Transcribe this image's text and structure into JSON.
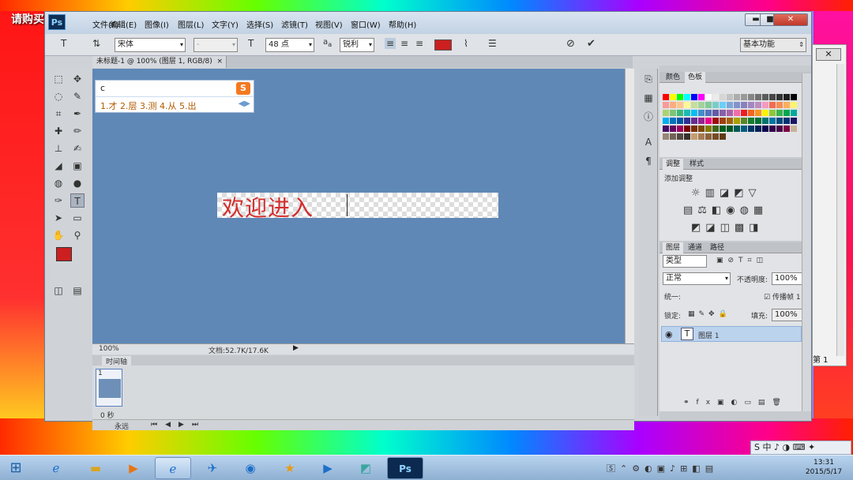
{
  "watermark": "请购买正式版",
  "window": {
    "logo": "Ps",
    "controls": {
      "minimize": "▬",
      "maximize": "■",
      "close": "✕"
    }
  },
  "menu": [
    "文件(F)",
    "编辑(E)",
    "图像(I)",
    "图层(L)",
    "文字(Y)",
    "选择(S)",
    "滤镜(T)",
    "视图(V)",
    "窗口(W)",
    "帮助(H)"
  ],
  "options": {
    "font_family": "宋体",
    "font_style": "-",
    "font_size": "48 点",
    "antialias_icon": "a",
    "antialias_label": "a",
    "antialias": "锐利",
    "text_color": "#cc1f1f",
    "workspace": "基本功能"
  },
  "document": {
    "tab_title": "未标题-1 @ 100% (图层 1, RGB/8)",
    "tab_close": "×",
    "canvas_text": "欢迎进入",
    "zoom": "100%",
    "doc_size": "文档:52.7K/17.6K"
  },
  "ime": {
    "input": "c",
    "candidates": "1.才 2.层 3.测 4.从 5.出",
    "logo": "S"
  },
  "timeline": {
    "title": "时间轴",
    "frame_number": "1",
    "frame_delay": "0 秒",
    "loop": "永远"
  },
  "panels": {
    "color_tabs": [
      "颜色",
      "色板"
    ],
    "adjust_tabs": [
      "调整",
      "样式"
    ],
    "adjust_add": "添加调整",
    "layers_tabs": [
      "图层",
      "通道",
      "路径"
    ],
    "filter_kind": "类型",
    "blend_mode": "正常",
    "opacity_label": "不透明度:",
    "opacity": "100%",
    "unify_label": "统一:",
    "propagate": "传播帧",
    "propagate_value": "1",
    "lock_label": "锁定:",
    "fill_label": "填充:",
    "fill": "100%",
    "layer_name": "图层 1"
  },
  "side_window": {
    "page_label": "第 1"
  },
  "taskbar": {
    "time": "13:31",
    "date": "2015/5/17"
  },
  "swatch_colors": [
    "#ff0000",
    "#ffff00",
    "#00ff00",
    "#00ffff",
    "#0000ff",
    "#ff00ff",
    "#ffffff",
    "#ebebeb",
    "#d6d6d6",
    "#c2c2c2",
    "#adadad",
    "#999999",
    "#858585",
    "#707070",
    "#5c5c5c",
    "#474747",
    "#333333",
    "#1f1f1f",
    "#000000",
    "#f79a9a",
    "#f9ad81",
    "#fdc68a",
    "#fff799",
    "#c4df9b",
    "#a3d39c",
    "#82ca9c",
    "#7accc8",
    "#6dcff6",
    "#7da7d9",
    "#8393ca",
    "#8781bd",
    "#a187be",
    "#bd8cbf",
    "#f49ac1",
    "#f26c4f",
    "#f68e55",
    "#fbaf5d",
    "#fff467",
    "#acd372",
    "#7cc576",
    "#3bb878",
    "#1abbb4",
    "#00bff3",
    "#448ccb",
    "#5574b9",
    "#605ca8",
    "#8560a8",
    "#a863a8",
    "#f06eaa",
    "#ed1c24",
    "#f26522",
    "#f7941d",
    "#fff200",
    "#8dc63f",
    "#39b54a",
    "#00a651",
    "#00a99d",
    "#00aeef",
    "#0072bc",
    "#0054a6",
    "#2e3192",
    "#662d91",
    "#92278f",
    "#ec008c",
    "#9e0b0f",
    "#a0410d",
    "#a36209",
    "#aba000",
    "#598527",
    "#197b30",
    "#007236",
    "#00746b",
    "#0076a3",
    "#004b80",
    "#003471",
    "#1b1464",
    "#440e62",
    "#630460",
    "#9e005d",
    "#790000",
    "#7b2e00",
    "#7d4900",
    "#827b00",
    "#406618",
    "#005e20",
    "#005826",
    "#005952",
    "#005b7f",
    "#003663",
    "#002157",
    "#0d004c",
    "#32004b",
    "#4b0049",
    "#7b0046",
    "#c7b299",
    "#998675",
    "#736357",
    "#534741",
    "#37302d",
    "#c69c6d",
    "#a67c52",
    "#8c6239",
    "#754c24",
    "#603913"
  ]
}
